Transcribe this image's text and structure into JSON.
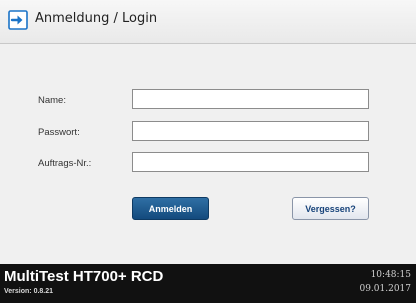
{
  "header": {
    "title": "Anmeldung / Login",
    "icon": "login-arrow-icon",
    "icon_color": "#1a73c7"
  },
  "form": {
    "name_label": "Name:",
    "name_value": "",
    "password_label": "Passwort:",
    "password_value": "",
    "order_label": "Auftrags-Nr.:",
    "order_value": ""
  },
  "buttons": {
    "login_label": "Anmelden",
    "forgot_label": "Vergessen?"
  },
  "footer": {
    "app_name": "MultiTest HT700+ RCD",
    "version": "Version: 0.8.21",
    "time": "10:48:15",
    "date": "09.01.2017"
  },
  "colors": {
    "accent": "#1f5b90",
    "footer_bg": "#111111"
  }
}
